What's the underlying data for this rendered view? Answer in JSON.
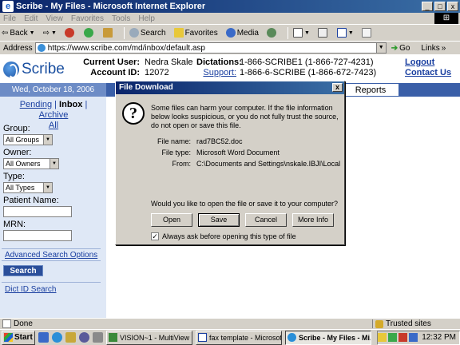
{
  "window": {
    "title": "Scribe - My Files - Microsoft Internet Explorer",
    "win_logo": "⊞"
  },
  "menu": [
    "File",
    "Edit",
    "View",
    "Favorites",
    "Tools",
    "Help"
  ],
  "toolbar": {
    "back": "Back",
    "search": "Search",
    "favorites": "Favorites",
    "media": "Media"
  },
  "address": {
    "label": "Address",
    "url": "https://www.scribe.com/md/inbox/default.asp",
    "go": "Go",
    "links": "Links"
  },
  "site": {
    "logo_text": "Scribe",
    "current_user_label": "Current User:",
    "current_user": "Nedra Skale",
    "account_label": "Account ID:",
    "account_id": "12072",
    "dictations_label": "Dictations:",
    "dictations_value": "1-866-SCRIBE1 (1-866-727-4231)",
    "support_label": "Support:",
    "support_value": "1-866-6-SCRIBE (1-866-672-7423)",
    "logout": "Logout",
    "contact": "Contact Us",
    "date": "Wed, October 18, 2006",
    "reports_tab": "Reports"
  },
  "sidebar": {
    "pending": "Pending",
    "inbox": "Inbox",
    "archive": "Archive",
    "all": "All",
    "group_label": "Group:",
    "group_value": "All Groups",
    "owner_label": "Owner:",
    "owner_value": "All Owners",
    "type_label": "Type:",
    "type_value": "All Types",
    "patient_label": "Patient Name:",
    "mrn_label": "MRN:",
    "advanced": "Advanced Search Options",
    "search_btn": "Search",
    "dictid": "Dict ID Search"
  },
  "dialog": {
    "title": "File Download",
    "close": "x",
    "warning": "Some files can harm your computer. If the file information below looks suspicious, or you do not fully trust the source, do not open or save this file.",
    "file_name_label": "File name:",
    "file_name": "rad7BC52.doc",
    "file_type_label": "File type:",
    "file_type": "Microsoft Word Document",
    "from_label": "From:",
    "from": "C:\\Documents and Settings\\nskale.IBJI\\Local Sett",
    "question": "Would you like to open the file or save it to your computer?",
    "open": "Open",
    "save": "Save",
    "cancel": "Cancel",
    "more_info": "More Info",
    "checkbox_label": "Always ask before opening this type of file",
    "checked": true
  },
  "status": {
    "text": "Done",
    "zone": "Trusted sites"
  },
  "taskbar": {
    "start": "Start",
    "tasks": [
      {
        "label": "VISION~1 - MultiView 2...",
        "active": false
      },
      {
        "label": "fax template - Microsoft...",
        "active": false
      },
      {
        "label": "Scribe - My Files - Mi...",
        "active": true
      }
    ],
    "clock": "12:32 PM"
  },
  "colors": {
    "titlebar": "#0a246a",
    "site_blue": "#3a5fa8",
    "sidebar_bg": "#dfe8f6",
    "link": "#1a3fa0"
  }
}
